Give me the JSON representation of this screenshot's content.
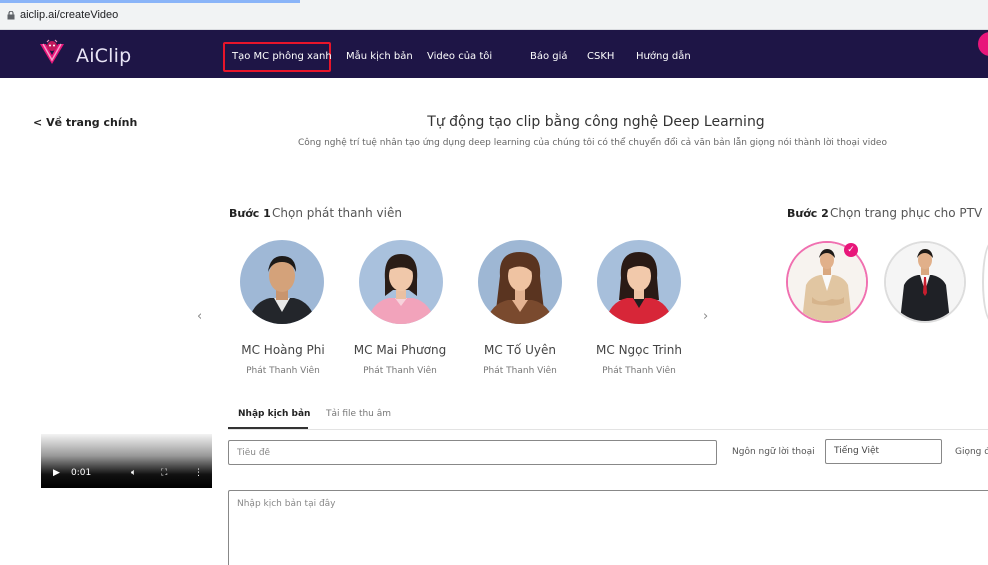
{
  "browser": {
    "url": "aiclip.ai/createVideo"
  },
  "brand": {
    "name": "AiClip",
    "accent": "#e8167a",
    "nav_bg": "#1e1546"
  },
  "nav": {
    "items": [
      {
        "label": "Tạo MC phông xanh",
        "active": true
      },
      {
        "label": "Mẫu kịch bản"
      },
      {
        "label": "Video của tôi"
      },
      {
        "label": "Báo giá"
      },
      {
        "label": "CSKH"
      },
      {
        "label": "Hướng dẫn"
      }
    ]
  },
  "header": {
    "back_label": "Về trang chính",
    "title": "Tự động tạo clip bằng công nghệ Deep Learning",
    "subtitle": "Công nghệ trí tuệ nhân tạo ứng dụng deep learning của chúng tôi có thể chuyển đổi cả văn bản lẫn giọng nói thành lời thoại video"
  },
  "step1": {
    "label": "Bước 1",
    "text": "Chọn phát thanh viên",
    "presenters": [
      {
        "name": "MC Hoàng Phi",
        "role": "Phát Thanh Viên"
      },
      {
        "name": "MC Mai Phương",
        "role": "Phát Thanh Viên"
      },
      {
        "name": "MC Tố Uyên",
        "role": "Phát Thanh Viên"
      },
      {
        "name": "MC Ngọc Trinh",
        "role": "Phát Thanh Viên"
      }
    ]
  },
  "step2": {
    "label": "Bước 2",
    "text": "Chọn trang phục cho PTV",
    "selected_index": 0
  },
  "tabs": [
    {
      "label": "Nhập kịch bản",
      "active": true
    },
    {
      "label": "Tải file thu âm"
    }
  ],
  "video": {
    "time": "0:01"
  },
  "form": {
    "title_placeholder": "Tiêu đề",
    "language_label": "Ngôn ngữ lời thoại",
    "language_value": "Tiếng Việt",
    "voice_label": "Giọng đ",
    "script_placeholder": "Nhập kịch bản tại đây"
  }
}
